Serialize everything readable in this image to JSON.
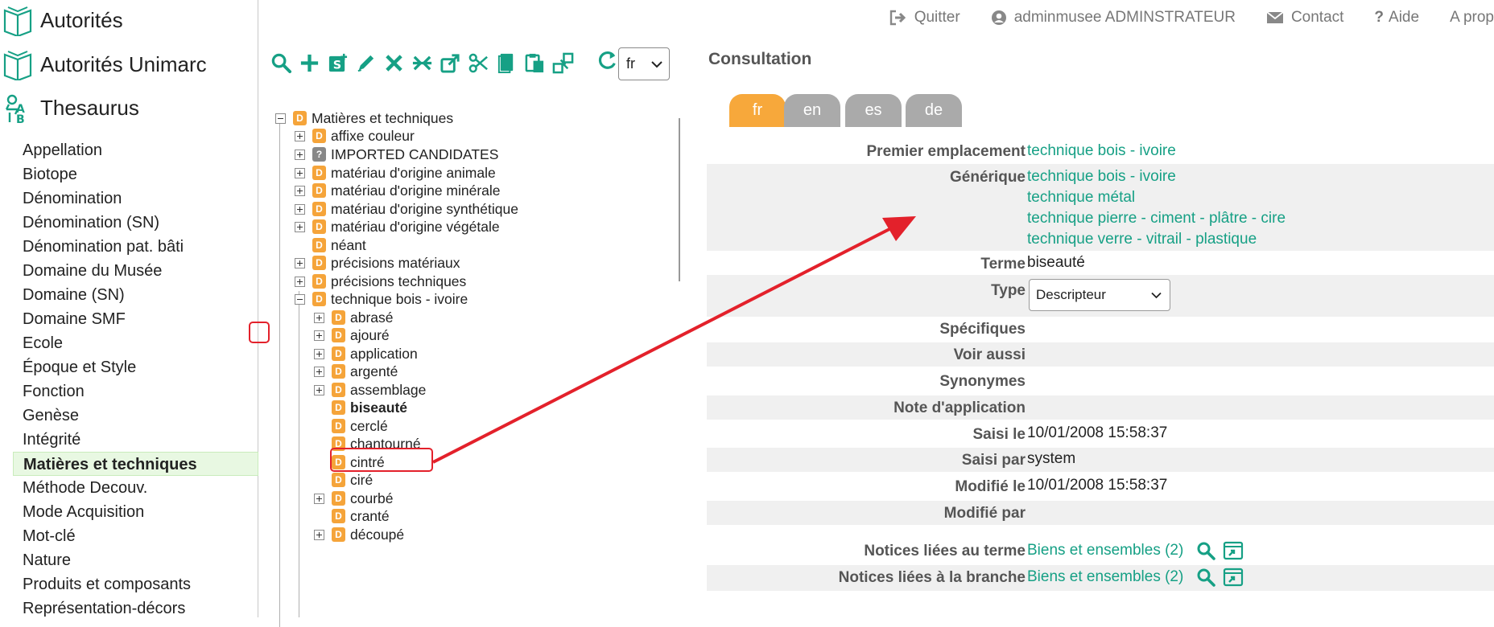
{
  "sidebar": {
    "modules": [
      {
        "label": "Autorités",
        "icon": "book-icon"
      },
      {
        "label": "Autorités Unimarc",
        "icon": "book-icon"
      },
      {
        "label": "Thesaurus",
        "icon": "thesaurus-ab-icon"
      }
    ],
    "items": [
      "Appellation",
      "Biotope",
      "Dénomination",
      "Dénomination (SN)",
      "Dénomination pat. bâti",
      "Domaine du Musée",
      "Domaine (SN)",
      "Domaine SMF",
      "Ecole",
      "Époque et Style",
      "Fonction",
      "Genèse",
      "Intégrité",
      "Matières et techniques",
      "Méthode Decouv.",
      "Mode Acquisition",
      "Mot-clé",
      "Nature",
      "Produits et composants",
      "Représentation-décors"
    ],
    "active_item": "Matières et techniques"
  },
  "toolbar": {
    "icons": [
      "search-icon",
      "add-icon",
      "add-synonym-icon",
      "edit-icon",
      "delete-icon",
      "merge-icon",
      "move-icon",
      "cut-icon",
      "copy-icon",
      "paste-icon",
      "sitemap-icon"
    ],
    "refresh_icon": "refresh-icon",
    "language": "fr"
  },
  "tree": {
    "root": {
      "label": "Matières et techniques",
      "badge": "D"
    },
    "items": [
      {
        "label": "affixe couleur",
        "badge": "D"
      },
      {
        "label": "IMPORTED CANDIDATES",
        "badge": "?"
      },
      {
        "label": "matériau d'origine animale",
        "badge": "D"
      },
      {
        "label": "matériau d'origine minérale",
        "badge": "D"
      },
      {
        "label": "matériau d'origine synthétique",
        "badge": "D"
      },
      {
        "label": "matériau d'origine végétale",
        "badge": "D"
      },
      {
        "label": "néant",
        "badge": "D"
      },
      {
        "label": "précisions matériaux",
        "badge": "D"
      },
      {
        "label": "précisions techniques",
        "badge": "D"
      },
      {
        "label": "technique bois - ivoire",
        "badge": "D"
      }
    ],
    "children": [
      {
        "label": "abrasé",
        "badge": "D"
      },
      {
        "label": "ajouré",
        "badge": "D"
      },
      {
        "label": "application",
        "badge": "D"
      },
      {
        "label": "argenté",
        "badge": "D"
      },
      {
        "label": "assemblage",
        "badge": "D"
      },
      {
        "label": "biseauté",
        "badge": "D"
      },
      {
        "label": "cerclé",
        "badge": "D"
      },
      {
        "label": "chantourné",
        "badge": "D"
      },
      {
        "label": "cintré",
        "badge": "D"
      },
      {
        "label": "ciré",
        "badge": "D"
      },
      {
        "label": "courbé",
        "badge": "D"
      },
      {
        "label": "cranté",
        "badge": "D"
      },
      {
        "label": "découpé",
        "badge": "D"
      }
    ]
  },
  "topnav": {
    "quit": "Quitter",
    "user": "adminmusee ADMINSTRATEUR",
    "contact": "Contact",
    "help": "Aide",
    "about": "A prop"
  },
  "consultation": {
    "title": "Consultation",
    "tabs": [
      "fr",
      "en",
      "es",
      "de"
    ],
    "fields": {
      "premier_label": "Premier emplacement",
      "premier_value": "technique bois - ivoire",
      "generique_label": "Générique",
      "generique_values": [
        "technique bois - ivoire",
        "technique métal",
        "technique pierre - ciment - plâtre - cire",
        "technique verre - vitrail - plastique"
      ],
      "terme_label": "Terme",
      "terme_value": "biseauté",
      "type_label": "Type",
      "type_value": "Descripteur",
      "specifiques_label": "Spécifiques",
      "voir_aussi_label": "Voir aussi",
      "synonymes_label": "Synonymes",
      "note_label": "Note d'application",
      "saisi_le_label": "Saisi le",
      "saisi_le_value": "10/01/2008 15:58:37",
      "saisi_par_label": "Saisi par",
      "saisi_par_value": "system",
      "modifie_le_label": "Modifié le",
      "modifie_le_value": "10/01/2008 15:58:37",
      "modifie_par_label": "Modifié par",
      "notices_terme_label": "Notices liées au terme",
      "notices_terme_value": "Biens et ensembles (2)",
      "notices_branche_label": "Notices liées à la branche",
      "notices_branche_value": "Biens et ensembles (2)"
    }
  },
  "colors": {
    "accent_green": "#16a085",
    "active_tab": "#f7a83b",
    "badge_orange": "#f5a43a",
    "highlight_red": "#e3212b",
    "active_nav_bg": "#e8f8e2"
  }
}
